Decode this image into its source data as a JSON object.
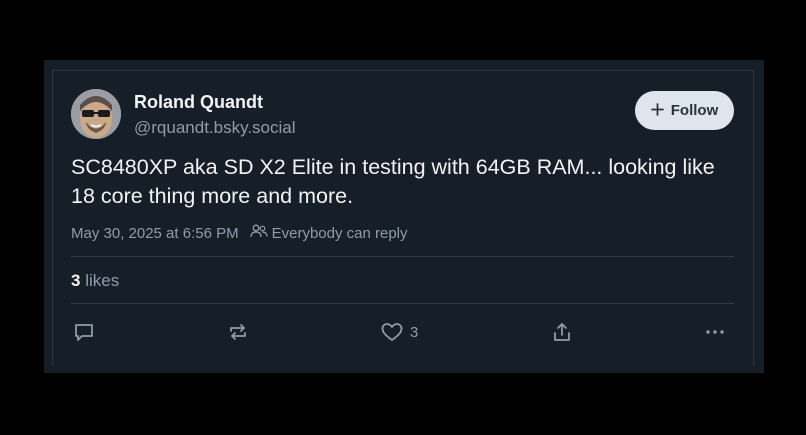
{
  "author": {
    "name": "Roland Quandt",
    "handle": "@rquandt.bsky.social"
  },
  "follow_button": {
    "icon": "plus-icon",
    "label": "Follow"
  },
  "post": {
    "text": "SC8480XP aka SD X2 Elite in testing with 64GB RAM... looking like 18 core thing more and more.",
    "timestamp": "May 30, 2025 at 6:56 PM",
    "reply_setting": "Everybody can reply"
  },
  "likes": {
    "count": "3",
    "label": "likes"
  },
  "actions": {
    "reply_icon": "reply-icon",
    "repost_icon": "repost-icon",
    "like_icon": "heart-icon",
    "like_count": "3",
    "share_icon": "share-icon",
    "more_icon": "more-icon"
  },
  "colors": {
    "background": "#000000",
    "card": "#161e27",
    "text_primary": "#f1f3f5",
    "text_secondary": "#8f9cab",
    "follow_button_bg": "#dfe5ec"
  }
}
